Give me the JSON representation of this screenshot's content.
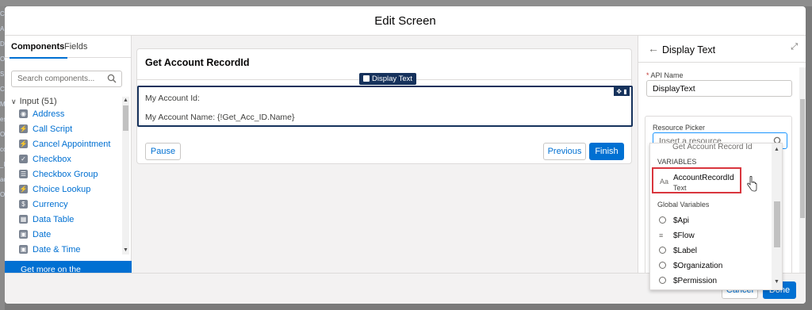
{
  "modal": {
    "title": "Edit Screen"
  },
  "background_letters": [
    "C",
    "A",
    "D",
    "O",
    "S",
    "C",
    "",
    "",
    "",
    "Ma",
    "es",
    "Ou",
    "",
    "",
    "",
    "cc",
    "_ll",
    "ad",
    "Ou"
  ],
  "left_panel": {
    "tabs": [
      "Components",
      "Fields"
    ],
    "search_placeholder": "Search components...",
    "section": "Input (51)",
    "items": [
      {
        "label": "Address",
        "icon": "address-icon"
      },
      {
        "label": "Call Script",
        "icon": "flash-icon"
      },
      {
        "label": "Cancel Appointment",
        "icon": "flash-icon"
      },
      {
        "label": "Checkbox",
        "icon": "checkbox-icon"
      },
      {
        "label": "Checkbox Group",
        "icon": "checkbox-group-icon"
      },
      {
        "label": "Choice Lookup",
        "icon": "flash-icon"
      },
      {
        "label": "Currency",
        "icon": "currency-icon"
      },
      {
        "label": "Data Table",
        "icon": "table-icon"
      },
      {
        "label": "Date",
        "icon": "date-icon"
      },
      {
        "label": "Date & Time",
        "icon": "datetime-icon"
      }
    ],
    "appexchange": "Get more on the AppExchange"
  },
  "canvas": {
    "title": "Get Account RecordId",
    "badge": "Display Text",
    "line1": "My Account Id:",
    "line2": "My Account Name: {!Get_Acc_ID.Name}",
    "pause": "Pause",
    "previous": "Previous",
    "finish": "Finish"
  },
  "right_panel": {
    "title": "Display Text",
    "api_label": "API Name",
    "api_required": "*",
    "api_value": "DisplayText",
    "resource_label": "Resource Picker",
    "resource_placeholder": "Insert a resource..."
  },
  "dropdown": {
    "cut_item": "Get Account Record Id",
    "variables_header": "VARIABLES",
    "var_name": "AccountRecordId",
    "var_type": "Text",
    "var_icon": "Aa",
    "global_header": "Global Variables",
    "globals": [
      "$Api",
      "$Flow",
      "$Label",
      "$Organization",
      "$Permission"
    ]
  },
  "footer": {
    "cancel": "Cancel",
    "done": "Done"
  },
  "colors": {
    "brand": "#0070d2",
    "highlight": "#d9363e",
    "navy": "#16325c"
  }
}
